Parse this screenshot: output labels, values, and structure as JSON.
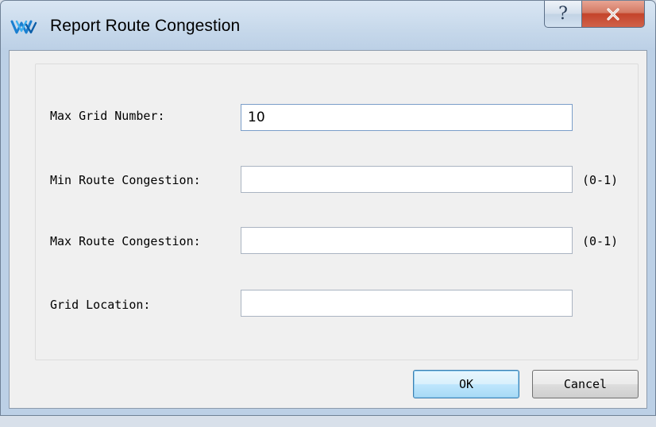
{
  "window": {
    "title": "Report Route Congestion",
    "icon": "gowin-logo-icon",
    "help_glyph": "?",
    "close_glyph": "X",
    "accent_color": "#3c7fb1",
    "close_color": "#c4432a"
  },
  "form": {
    "max_grid_number": {
      "label": "Max Grid Number:",
      "value": "10"
    },
    "min_route_congestion": {
      "label": "Min Route Congestion:",
      "value": "",
      "range": "(0-1)"
    },
    "max_route_congestion": {
      "label": "Max Route Congestion:",
      "value": "",
      "range": "(0-1)"
    },
    "grid_location": {
      "label": "Grid Location:",
      "value": ""
    }
  },
  "buttons": {
    "ok": "OK",
    "cancel": "Cancel"
  }
}
